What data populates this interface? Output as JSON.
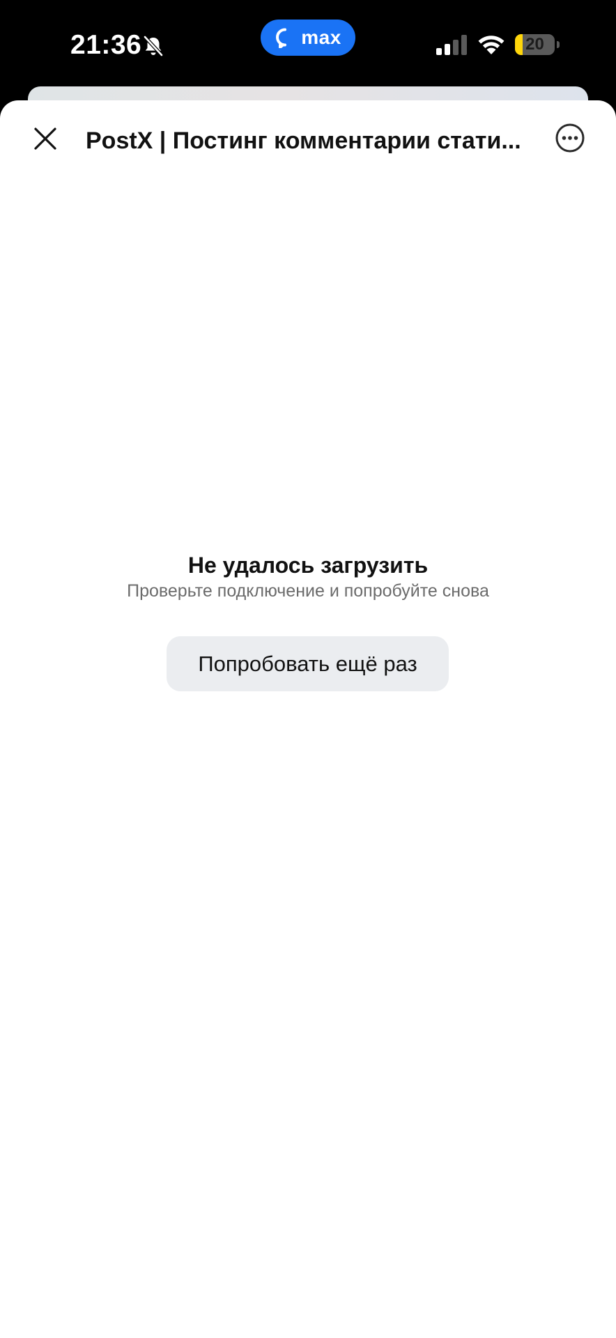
{
  "status_bar": {
    "time": "21:36",
    "app_pill_label": "max",
    "battery_level": "20",
    "battery_fraction": 0.2,
    "notifications_muted": true,
    "colors": {
      "pill": "#1a73f5",
      "battery_fill": "#ffd60a"
    }
  },
  "header": {
    "title": "PostX | Постинг комментарии стати...",
    "close_icon": "close-icon",
    "more_icon": "more-horizontal-circle-icon"
  },
  "error": {
    "title": "Не удалось загрузить",
    "subtitle": "Проверьте подключение и попробуйте снова",
    "retry_label": "Попробовать ещё раз"
  }
}
